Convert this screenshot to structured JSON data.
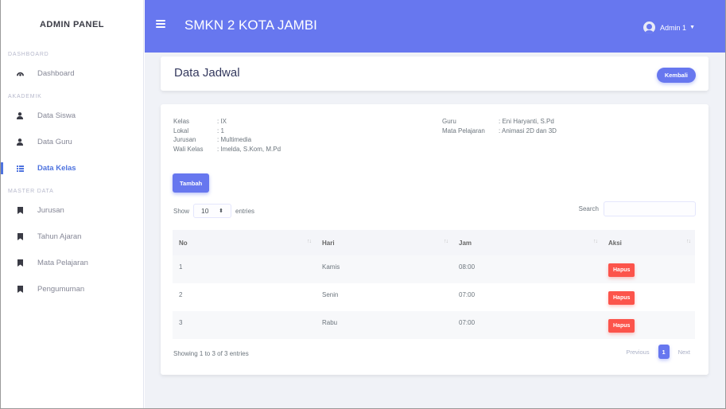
{
  "sidebar": {
    "brand": "ADMIN PANEL",
    "sections": [
      {
        "heading": "DASHBOARD"
      },
      {
        "heading": "AKADEMIK"
      },
      {
        "heading": "MASTER DATA"
      }
    ],
    "items": [
      {
        "label": "Dashboard",
        "icon": "dashboard-icon"
      },
      {
        "label": "Data Siswa",
        "icon": "user-icon"
      },
      {
        "label": "Data Guru",
        "icon": "user-icon"
      },
      {
        "label": "Data Kelas",
        "icon": "table-icon",
        "active": true
      },
      {
        "label": "Jurusan",
        "icon": "bookmark-icon"
      },
      {
        "label": "Tahun Ajaran",
        "icon": "bookmark-icon"
      },
      {
        "label": "Mata Pelajaran",
        "icon": "bookmark-icon"
      },
      {
        "label": "Pengumuman",
        "icon": "bookmark-icon"
      }
    ]
  },
  "topbar": {
    "title": "SMKN 2 KOTA JAMBI",
    "user": "Admin 1"
  },
  "header": {
    "title": "Data Jadwal",
    "back_button": "Kembali"
  },
  "info": {
    "left": [
      {
        "label": "Kelas",
        "value": ": IX"
      },
      {
        "label": "Lokal",
        "value": ": 1"
      },
      {
        "label": "Jurusan",
        "value": ": Multimedia"
      },
      {
        "label": "Wali Kelas",
        "value": ": Imelda, S.Kom, M.Pd"
      }
    ],
    "right": [
      {
        "label": "Guru",
        "value": ": Eni Haryanti, S.Pd"
      },
      {
        "label": "Mata Pelajaran",
        "value": ": Animasi 2D dan 3D"
      }
    ]
  },
  "add_button": "Tambah",
  "length": {
    "show": "Show",
    "value": "10",
    "entries": "entries"
  },
  "search": {
    "label": "Search",
    "value": ""
  },
  "table": {
    "columns": [
      "No",
      "Hari",
      "Jam",
      "Aksi"
    ],
    "rows": [
      {
        "no": "1",
        "hari": "Kamis",
        "jam": "08:00",
        "aksi": "Hapus"
      },
      {
        "no": "2",
        "hari": "Senin",
        "jam": "07:00",
        "aksi": "Hapus"
      },
      {
        "no": "3",
        "hari": "Rabu",
        "jam": "07:00",
        "aksi": "Hapus"
      }
    ]
  },
  "footer": {
    "showing": "Showing 1 to 3 of 3 entries",
    "previous": "Previous",
    "page": "1",
    "next": "Next"
  },
  "colors": {
    "primary": "#6777ef",
    "danger": "#fc544b",
    "sidebar_active": "#4e73df"
  }
}
